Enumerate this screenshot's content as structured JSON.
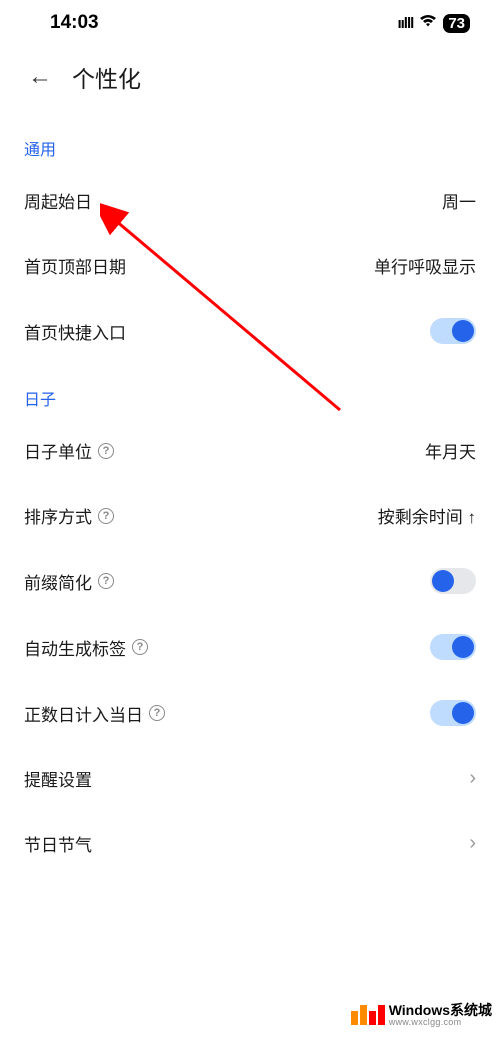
{
  "status": {
    "time": "14:03",
    "battery": "73"
  },
  "header": {
    "title": "个性化"
  },
  "sections": {
    "general": {
      "title": "通用",
      "week_start": {
        "label": "周起始日",
        "value": "周一"
      },
      "home_date": {
        "label": "首页顶部日期",
        "value": "单行呼吸显示"
      },
      "quick_entry": {
        "label": "首页快捷入口"
      }
    },
    "days": {
      "title": "日子",
      "unit": {
        "label": "日子单位",
        "value": "年月天"
      },
      "sort": {
        "label": "排序方式",
        "value": "按剩余时间 ↑"
      },
      "prefix": {
        "label": "前缀简化"
      },
      "auto_tag": {
        "label": "自动生成标签"
      },
      "positive_day": {
        "label": "正数日计入当日"
      },
      "reminder": {
        "label": "提醒设置"
      },
      "holiday": {
        "label": "节日节气"
      }
    }
  },
  "watermark": {
    "main": "Windows系统城",
    "sub": "www.wxclgg.com"
  }
}
